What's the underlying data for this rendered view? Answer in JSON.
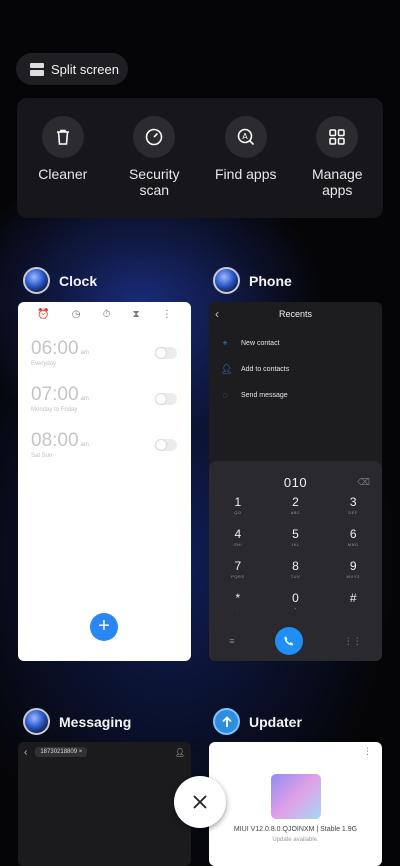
{
  "split_screen": {
    "label": "Split screen",
    "icon": "split-screen-icon"
  },
  "tools": [
    {
      "label": "Cleaner",
      "icon": "trash-icon"
    },
    {
      "label": "Security scan",
      "icon": "shield-check-icon"
    },
    {
      "label": "Find apps",
      "icon": "search-apps-icon"
    },
    {
      "label": "Manage apps",
      "icon": "grid-apps-icon"
    }
  ],
  "apps": {
    "clock": {
      "name": "Clock",
      "alarms": [
        {
          "time": "06:00",
          "ampm": "am",
          "days": "Everyday"
        },
        {
          "time": "07:00",
          "ampm": "am",
          "days": "Monday to Friday"
        },
        {
          "time": "08:00",
          "ampm": "am",
          "days": "Sat Sun"
        }
      ],
      "fab": "+"
    },
    "phone": {
      "name": "Phone",
      "header": "Recents",
      "actions": [
        "New contact",
        "Add to contacts",
        "Send message"
      ],
      "dialed": "010",
      "keys": [
        {
          "d": "1",
          "l": "QO"
        },
        {
          "d": "2",
          "l": "ABC"
        },
        {
          "d": "3",
          "l": "DEF"
        },
        {
          "d": "4",
          "l": "GHI"
        },
        {
          "d": "5",
          "l": "JKL"
        },
        {
          "d": "6",
          "l": "MNO"
        },
        {
          "d": "7",
          "l": "PQRS"
        },
        {
          "d": "8",
          "l": "TUV"
        },
        {
          "d": "9",
          "l": "WXYZ"
        },
        {
          "d": "*",
          "l": ","
        },
        {
          "d": "0",
          "l": "+"
        },
        {
          "d": "#",
          "l": ""
        }
      ]
    },
    "messaging": {
      "name": "Messaging",
      "recipient": "18730218809"
    },
    "updater": {
      "name": "Updater",
      "version": "MIUI V12.0.8.0.QJOINXM | Stable 1.9G",
      "status": "Update available."
    }
  },
  "close": {
    "icon": "close-icon"
  }
}
